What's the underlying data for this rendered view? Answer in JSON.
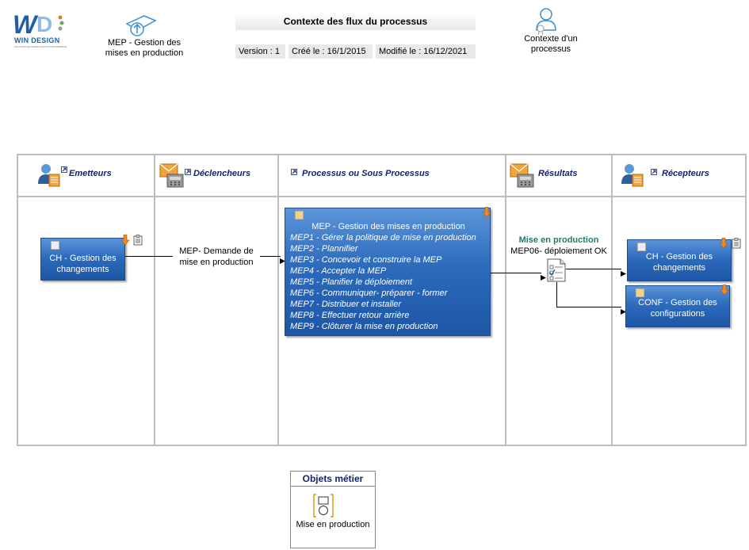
{
  "header": {
    "logo_brand": "WIN DESIGN",
    "logo_tagline": "SOLUTION DE MODÉLISATION D'ENTREPRISE",
    "process_name": "MEP - Gestion des mises en production",
    "info_title": "Contexte des flux du processus",
    "version": "Version : 1",
    "created": "Créé le : 16/1/2015",
    "modified": "Modifié le : 16/12/2021",
    "context_label": "Contexte d'un processus"
  },
  "columns": [
    {
      "label": "Emetteurs"
    },
    {
      "label": "Déclencheurs"
    },
    {
      "label": "Processus ou Sous Processus"
    },
    {
      "label": "Résultats"
    },
    {
      "label": "Récepteurs"
    }
  ],
  "emitter": {
    "label": "CH - Gestion des changements"
  },
  "trigger": {
    "label": "MEP- Demande de mise en production"
  },
  "process": {
    "title": "MEP - Gestion des mises en production",
    "items": [
      "MEP1 - Gérer la politique de mise en production",
      "MEP2 - Plannifier",
      "MEP3 - Concevoir et construire la MEP",
      "MEP4 - Accepter la MEP",
      "MEP5 - Planifier le déploiement",
      "MEP6 - Communiquer- préparer - former",
      "MEP7 - Distribuer et installer",
      "MEP8 - Effectuer retour arrière",
      "MEP9 - Clôturer la mise en production"
    ]
  },
  "result": {
    "title": "Mise en production",
    "subtitle": "MEP06- déploiement OK"
  },
  "receivers": [
    {
      "label": "CH - Gestion des changements"
    },
    {
      "label": "CONF - Gestion des configurations"
    }
  ],
  "business_objects": {
    "title": "Objets métier",
    "item": "Mise en production"
  },
  "colors": {
    "box_blue": "#2d6bbd",
    "header_navy": "#13236b",
    "result_green": "#1f7a6a",
    "grid_gray": "#bdbdbd"
  }
}
